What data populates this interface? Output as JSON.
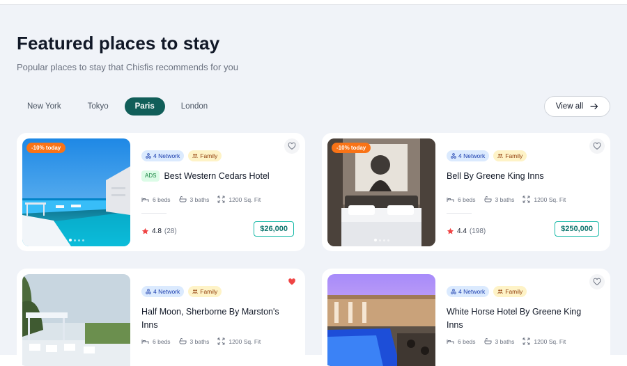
{
  "header": {
    "title": "Featured places to stay",
    "subtitle": "Popular places to stay that Chisfis recommends for you"
  },
  "tabs": [
    {
      "label": "New York",
      "active": false
    },
    {
      "label": "Tokyo",
      "active": false
    },
    {
      "label": "Paris",
      "active": true
    },
    {
      "label": "London",
      "active": false
    }
  ],
  "view_all": {
    "label": "View all",
    "icon": "arrow-right-icon"
  },
  "colors": {
    "accent": "#115e59",
    "price_border": "#14b8a6",
    "discount": "#f97316",
    "network_badge": "#dbeafe",
    "family_badge": "#fef3c7",
    "ads_badge": "#dcfce7",
    "star": "#ef4444"
  },
  "listings": [
    {
      "discount": "-10% today",
      "badge_network": "4 Network",
      "badge_family": "Family",
      "ads": "ADS",
      "name": "Best Western Cedars Hotel",
      "beds": "6 beds",
      "baths": "3 baths",
      "area": "1200 Sq. Fit",
      "rating": "4.8",
      "reviews": "(28)",
      "price": "$26,000",
      "liked": false
    },
    {
      "discount": "-10% today",
      "badge_network": "4 Network",
      "badge_family": "Family",
      "name": "Bell By Greene King Inns",
      "beds": "6 beds",
      "baths": "3 baths",
      "area": "1200 Sq. Fit",
      "rating": "4.4",
      "reviews": "(198)",
      "price": "$250,000",
      "liked": false
    },
    {
      "badge_network": "4 Network",
      "badge_family": "Family",
      "name": "Half Moon, Sherborne By Marston's Inns",
      "beds": "6 beds",
      "baths": "3 baths",
      "area": "1200 Sq. Fit",
      "liked": true
    },
    {
      "badge_network": "4 Network",
      "badge_family": "Family",
      "name": "White Horse Hotel By Greene King Inns",
      "beds": "6 beds",
      "baths": "3 baths",
      "area": "1200 Sq. Fit",
      "liked": false
    }
  ]
}
